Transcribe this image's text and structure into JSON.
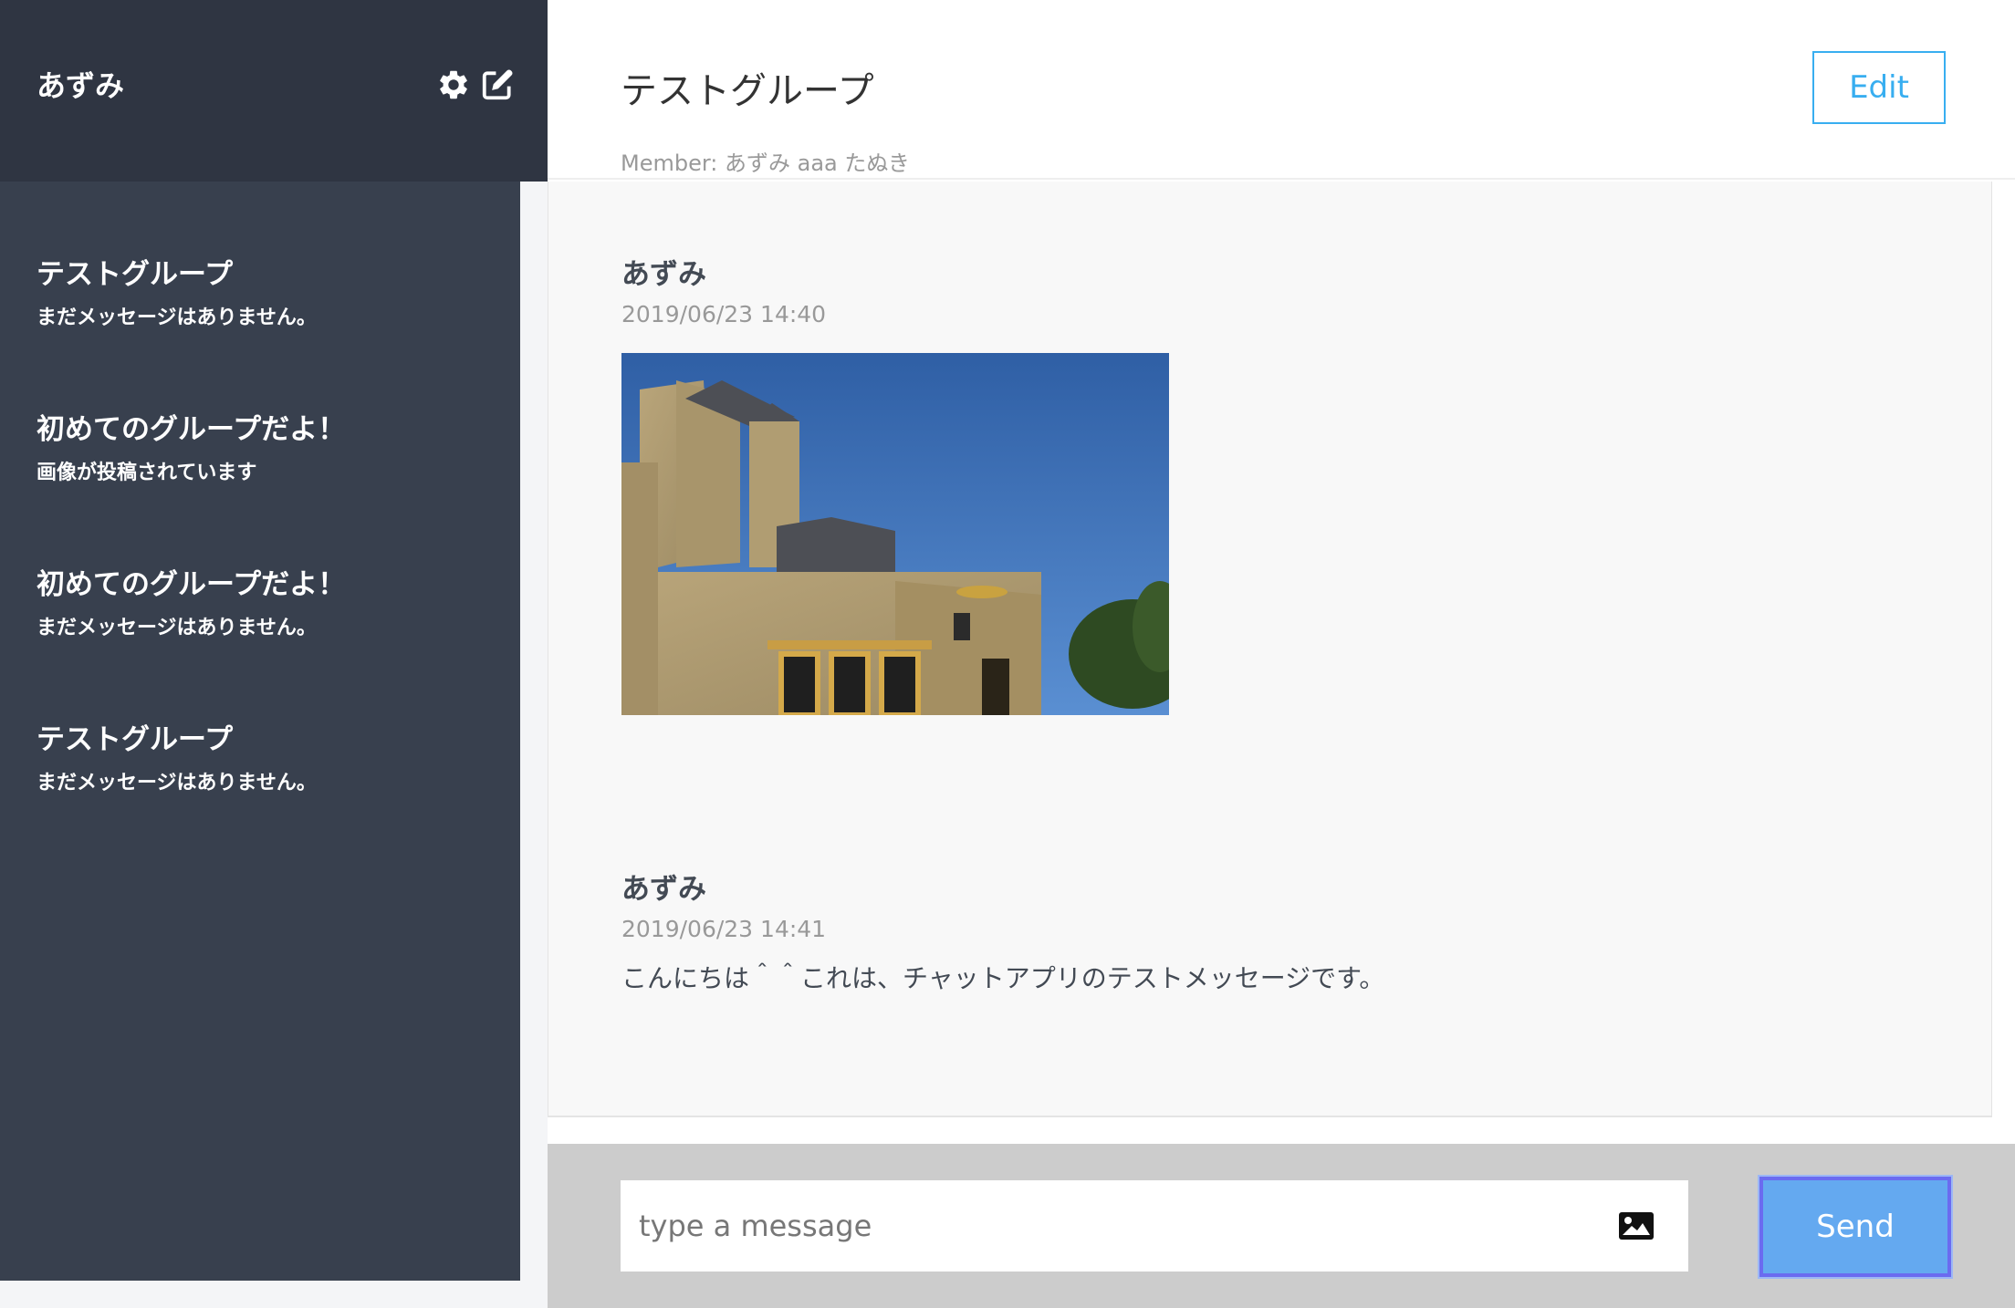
{
  "sidebar": {
    "user_name": "あずみ",
    "icons": [
      "gear-icon",
      "edit-icon"
    ],
    "groups": [
      {
        "name": "テストグループ",
        "last_message": "まだメッセージはありません。"
      },
      {
        "name": "初めてのグループだよ！",
        "last_message": "画像が投稿されています"
      },
      {
        "name": "初めてのグループだよ！",
        "last_message": "まだメッセージはありません。"
      },
      {
        "name": "テストグループ",
        "last_message": "まだメッセージはありません。"
      }
    ]
  },
  "main": {
    "title": "テストグループ",
    "members": "Member: あずみ aaa たぬき",
    "edit_label": "Edit"
  },
  "messages": [
    {
      "author": "あずみ",
      "time": "2019/06/23 14:40",
      "image": "castle-photo"
    },
    {
      "author": "あずみ",
      "time": "2019/06/23 14:41",
      "text": "こんにちは＾＾これは、チャットアプリのテストメッセージです。"
    }
  ],
  "form": {
    "placeholder": "type a message",
    "value": "",
    "image_icon": "image-icon",
    "send_label": "Send"
  },
  "colors": {
    "sidebar_header": "#2f3542",
    "sidebar": "#38404e",
    "accent": "#38aef0",
    "send_button": "#64a9f0"
  }
}
